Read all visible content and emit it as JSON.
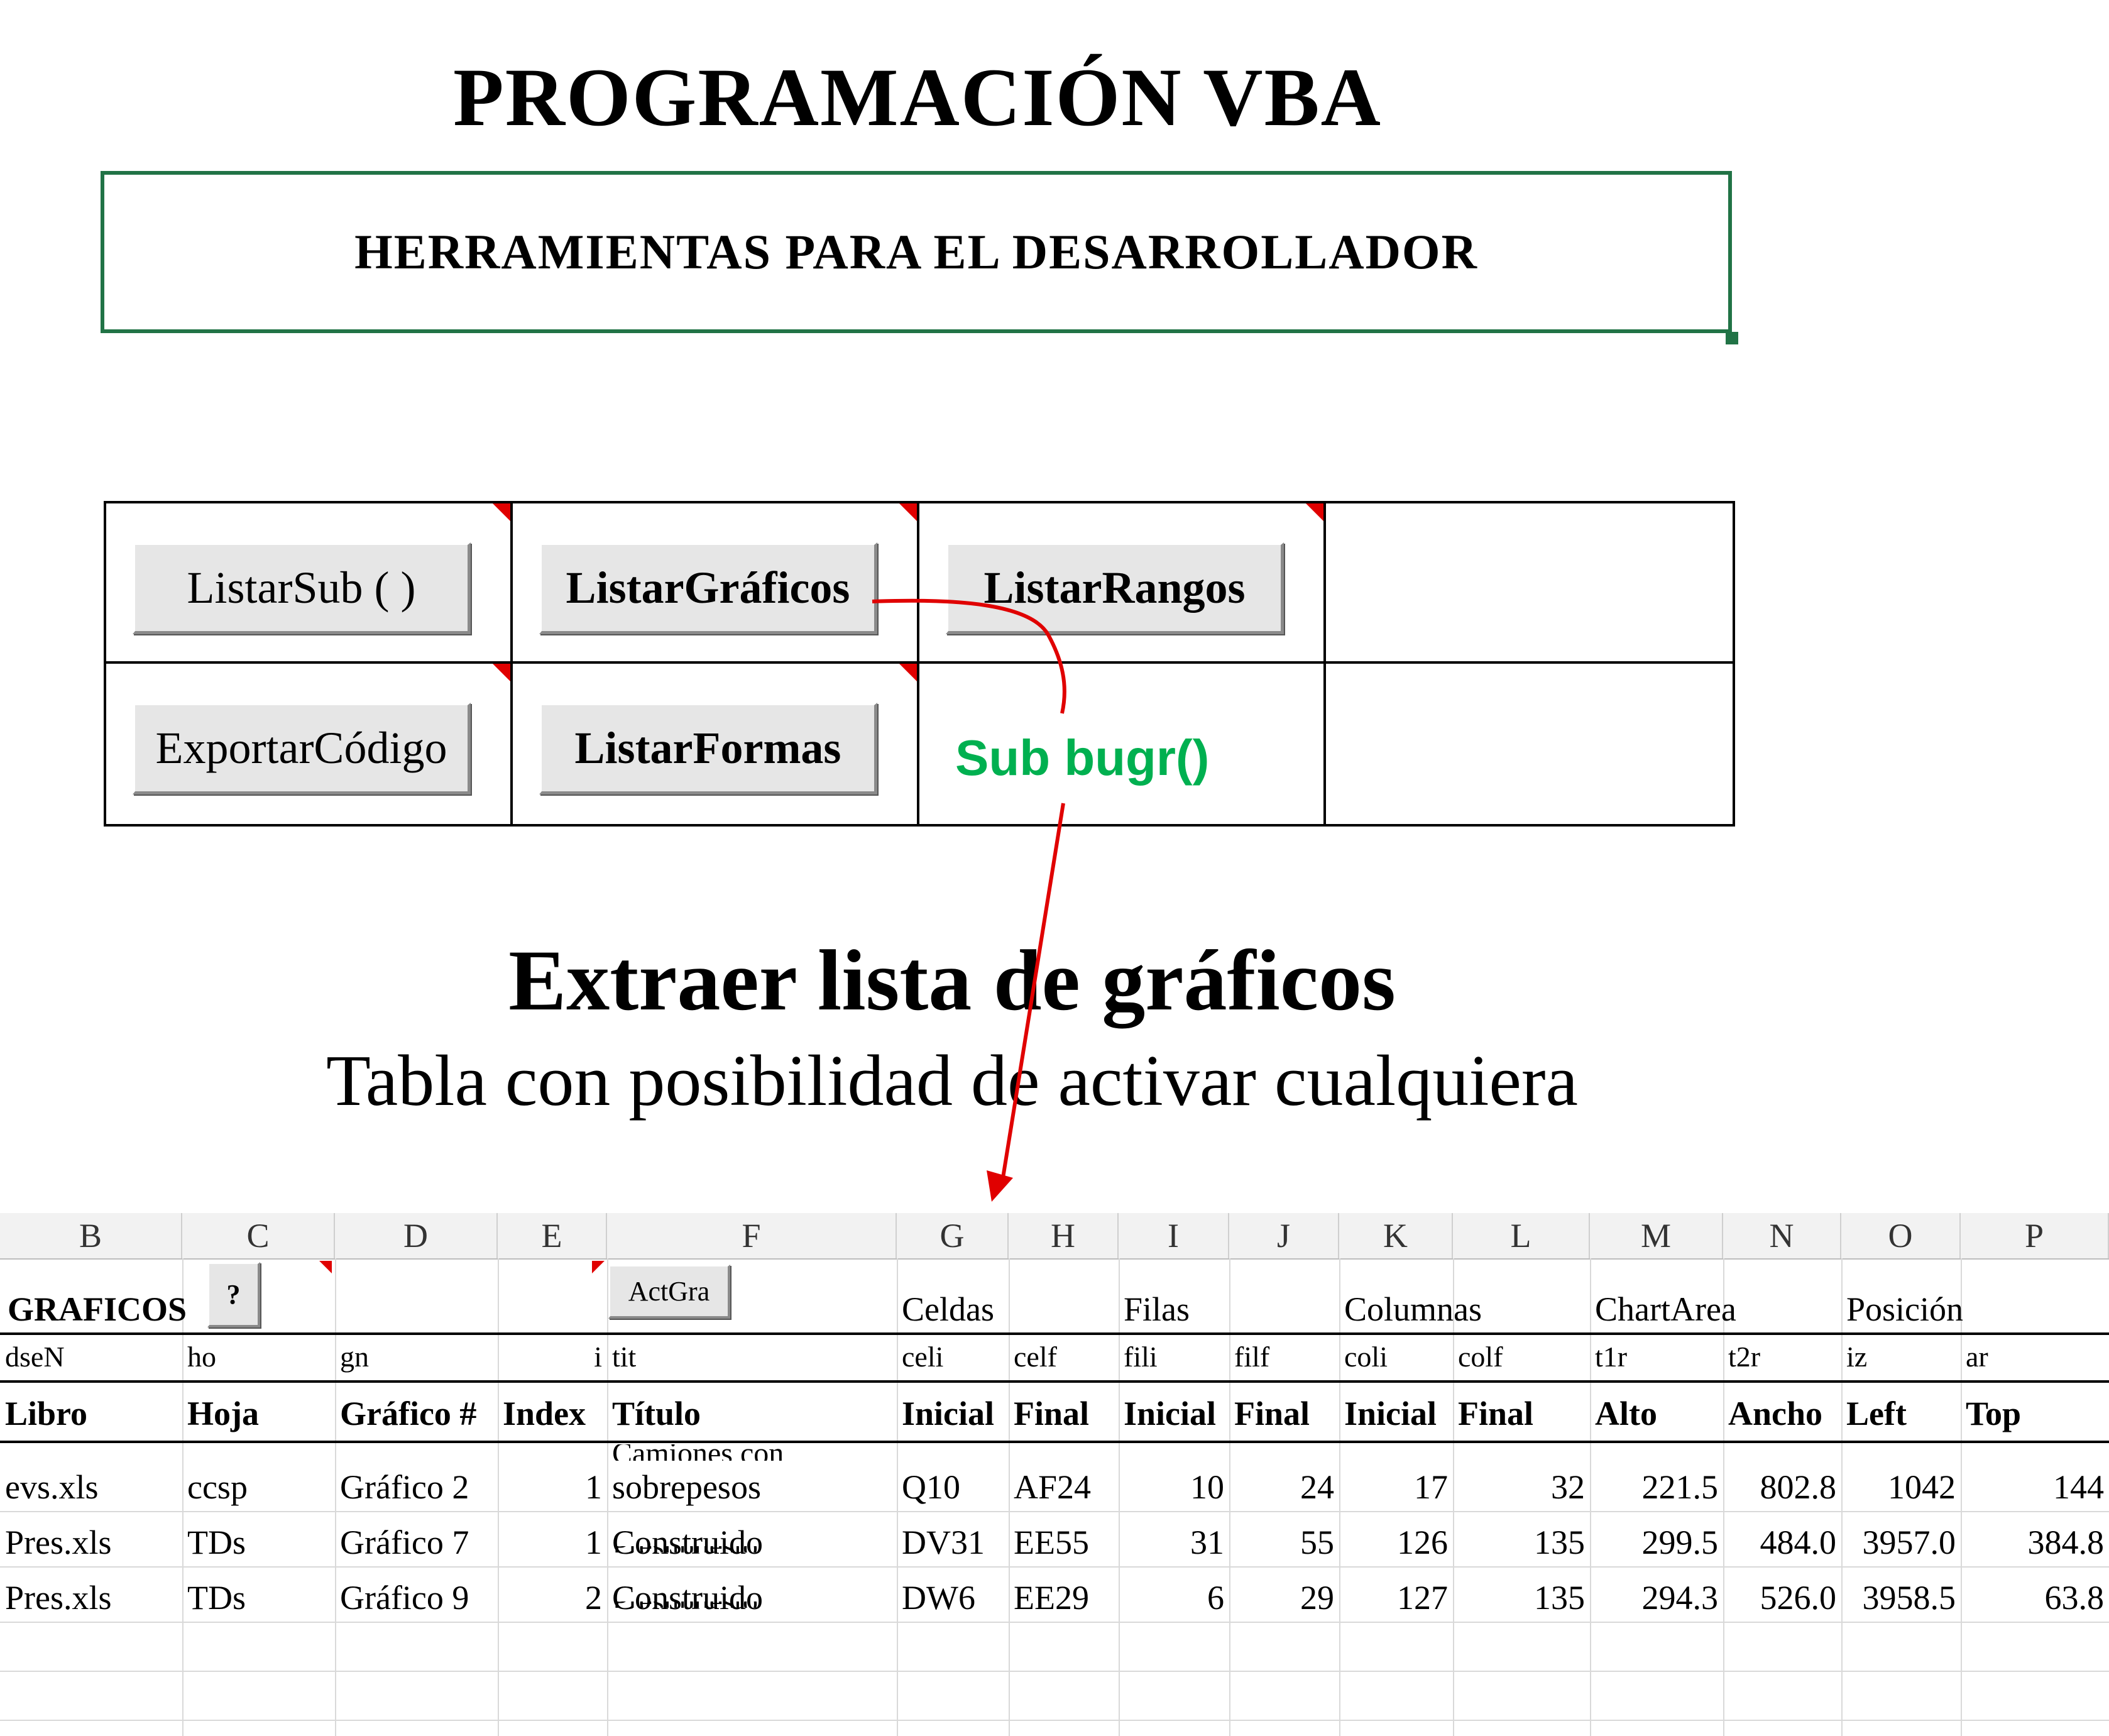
{
  "title": "PROGRAMACIÓN VBA",
  "banner": "HERRAMIENTAS PARA EL DESARROLLADOR",
  "macro_buttons": [
    "ListarSub ( )",
    "ListarGráficos",
    "ListarRangos",
    "ExportarCódigo",
    "ListarFormas"
  ],
  "annotation": "Sub bugr()",
  "section_title": "Extraer lista de gráficos",
  "section_subtitle": "Tabla con posibilidad de activar cualquiera",
  "sheet": {
    "columns": [
      "B",
      "C",
      "D",
      "E",
      "F",
      "G",
      "H",
      "I",
      "J",
      "K",
      "L",
      "M",
      "N",
      "O",
      "P"
    ],
    "title_cell": "GRAFICOS",
    "help_button": "?",
    "actgra_button": "ActGra",
    "group_labels": {
      "celdas": "Celdas",
      "filas": "Filas",
      "columnas": "Columnas",
      "chartarea": "ChartArea",
      "posicion": "Posición"
    },
    "var_names": [
      "dseN",
      "ho",
      "gn",
      "i",
      "tit",
      "celi",
      "celf",
      "fili",
      "filf",
      "coli",
      "colf",
      "t1r",
      "t2r",
      "iz",
      "ar"
    ],
    "headers": [
      "Libro",
      "Hoja",
      "Gráfico #",
      "Index",
      "Título",
      "Inicial",
      "Final",
      "Inicial",
      "Final",
      "Inicial",
      "Final",
      "Alto",
      "Ancho",
      "Left",
      "Top"
    ],
    "overflow_titles": [
      "Camiones con",
      "Presupuesto",
      "Presupuesto"
    ],
    "rows": [
      [
        "evs.xls",
        "ccsp",
        "Gráfico 2",
        "1",
        "sobrepesos",
        "Q10",
        "AF24",
        "10",
        "24",
        "17",
        "32",
        "221.5",
        "802.8",
        "1042",
        "144"
      ],
      [
        "Pres.xls",
        "TDs",
        "Gráfico 7",
        "1",
        "Construido",
        "DV31",
        "EE55",
        "31",
        "55",
        "126",
        "135",
        "299.5",
        "484.0",
        "3957.0",
        "384.8"
      ],
      [
        "Pres.xls",
        "TDs",
        "Gráfico 9",
        "2",
        "Construido",
        "DW6",
        "EE29",
        "6",
        "29",
        "127",
        "135",
        "294.3",
        "526.0",
        "3958.5",
        "63.8"
      ]
    ]
  },
  "colors": {
    "banner_border": "#217346",
    "annotation": "#00b050",
    "arrow": "#e00000",
    "comment_marker": "#e00000"
  }
}
